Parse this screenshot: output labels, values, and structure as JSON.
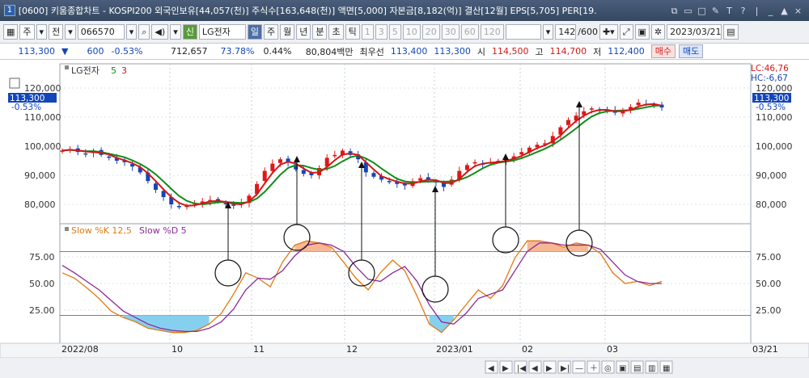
{
  "window": {
    "number": "1",
    "title": "[0600] 키움종합차트 - KOSPI200 외국인보유[44,057(천)] 주식수[163,648(천)] 액면[5,000] 자본금[8,182(억)] 결산[12월] EPS[5,705] PER[19.",
    "controls": [
      "⧉",
      "▭",
      "□",
      "✎",
      "T",
      "?",
      "|",
      "_",
      "▲",
      "×"
    ]
  },
  "toolbar": {
    "period": "주",
    "type": "전",
    "code": "066570",
    "badge": "신",
    "name": "LG전자",
    "intervals": [
      "일",
      "주",
      "월",
      "년",
      "분",
      "초",
      "틱"
    ],
    "active_interval": "일",
    "minutes": [
      "1",
      "3",
      "5",
      "10",
      "20",
      "30",
      "60",
      "120"
    ],
    "count": "142",
    "count_total": "/600",
    "date": "2023/03/21"
  },
  "quote": {
    "price": "113,300",
    "change": "600",
    "change_pct": "-0.53%",
    "volume": "712,657",
    "ratio": "73.78%",
    "turnover": "0.44%",
    "amount": "80,804백만",
    "best_ask_label": "최우선",
    "best_ask": "113,400",
    "best_bid": "113,300",
    "open_label": "시",
    "open": "114,500",
    "high_label": "고",
    "high": "114,700",
    "low_label": "저",
    "low": "112,400",
    "buy_label": "매수",
    "sell_label": "매도"
  },
  "chart_data": {
    "type": "line",
    "price_panel": {
      "legend": [
        "LG전자",
        "5",
        "3"
      ],
      "yticks": [
        "120,000",
        "110,000",
        "100,000",
        "90,000",
        "80,000"
      ],
      "ylim": [
        75000,
        125000
      ],
      "current_price": "113,300",
      "current_pct": "-0.53%",
      "lc": "LC:46,76",
      "hc": "HC:-6,67",
      "series": [
        {
          "name": "5",
          "color": "#d01818"
        },
        {
          "name": "3",
          "color": "#128c1a"
        }
      ],
      "close": [
        98500,
        99000,
        98000,
        97500,
        98500,
        97000,
        96000,
        95000,
        94500,
        93000,
        91000,
        88000,
        85000,
        82500,
        80000,
        79000,
        79500,
        80500,
        81000,
        81500,
        81000,
        80000,
        79500,
        80500,
        83000,
        87000,
        91500,
        94000,
        95500,
        94500,
        92000,
        90500,
        90000,
        92500,
        96000,
        97000,
        98500,
        97000,
        95500,
        91000,
        89500,
        88500,
        88000,
        87000,
        86500,
        88000,
        89000,
        88500,
        87500,
        86000,
        88500,
        91500,
        93500,
        94500,
        94000,
        94500,
        95000,
        95500,
        96500,
        98000,
        99500,
        100500,
        101000,
        103500,
        106500,
        109000,
        110500,
        112000,
        113000,
        112500,
        112000,
        111500,
        112500,
        113500,
        115000,
        114500,
        114000,
        113300
      ]
    },
    "osc_panel": {
      "legend": [
        "Slow %K 12,5",
        "Slow %D 5"
      ],
      "yticks": [
        "75.00",
        "50.00",
        "25.00"
      ],
      "ylim": [
        0,
        100
      ],
      "upper": 80,
      "lower": 20,
      "k": [
        60,
        55,
        46,
        36,
        24,
        18,
        14,
        8,
        6,
        4,
        4,
        6,
        12,
        22,
        40,
        60,
        55,
        47,
        70,
        86,
        90,
        88,
        84,
        70,
        55,
        44,
        60,
        72,
        62,
        38,
        12,
        4,
        16,
        30,
        44,
        36,
        48,
        74,
        90,
        90,
        88,
        84,
        88,
        86,
        78,
        60,
        50,
        52,
        48,
        52
      ],
      "d": [
        67,
        60,
        52,
        44,
        34,
        24,
        18,
        12,
        8,
        6,
        5,
        5,
        8,
        14,
        26,
        44,
        55,
        54,
        62,
        76,
        86,
        88,
        86,
        80,
        66,
        54,
        52,
        60,
        66,
        52,
        30,
        14,
        12,
        22,
        36,
        40,
        44,
        62,
        80,
        88,
        88,
        86,
        86,
        86,
        82,
        70,
        58,
        52,
        50,
        50
      ]
    },
    "xticks": [
      "2022/08",
      "10",
      "11",
      "12",
      "2023/01",
      "02",
      "03"
    ],
    "last_date": "03/21",
    "annotations": "arrows from oscillator circles up to price points"
  },
  "nav": [
    "◀",
    "▶",
    "|◀",
    "◀",
    "▶",
    "▶|",
    "—",
    "＋",
    "◎",
    "▣",
    "▤",
    "▥",
    "▦"
  ]
}
